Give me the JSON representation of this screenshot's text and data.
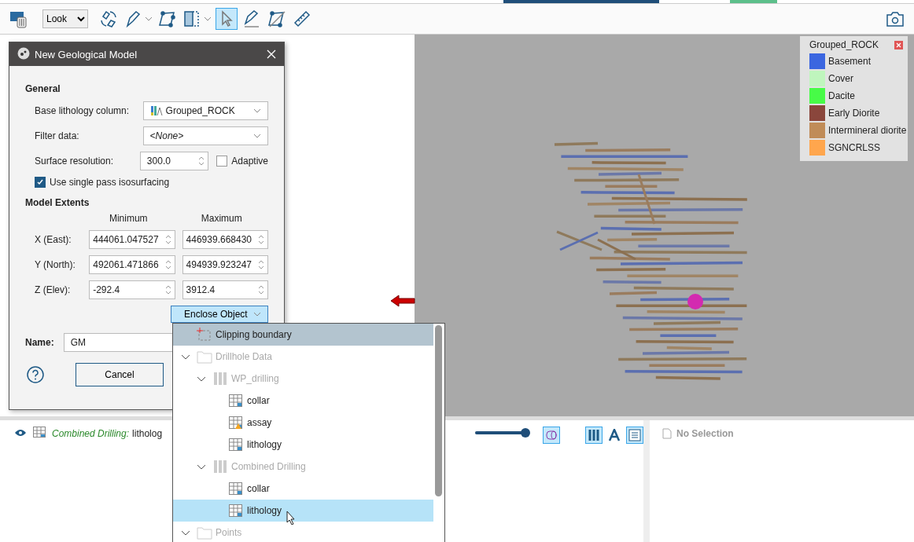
{
  "toolbar": {
    "view_mode": "Look",
    "tools": [
      {
        "kind": "layers",
        "selected": false,
        "menu": false
      },
      {
        "kind": "rotate",
        "selected": false,
        "menu": false
      },
      {
        "kind": "pen",
        "selected": false,
        "menu": true
      },
      {
        "kind": "polygon",
        "selected": false,
        "menu": false
      },
      {
        "kind": "slice",
        "selected": false,
        "menu": true
      },
      {
        "kind": "pointer",
        "selected": true,
        "menu": false
      },
      {
        "kind": "draw-line",
        "selected": false,
        "menu": false
      },
      {
        "kind": "polygon-edit",
        "selected": false,
        "menu": false
      },
      {
        "kind": "ruler",
        "selected": false,
        "menu": false
      }
    ]
  },
  "dialog": {
    "title": "New Geological Model",
    "general_heading": "General",
    "base_lithology": {
      "label": "Base lithology column:",
      "value": "Grouped_ROCK"
    },
    "filter": {
      "label": "Filter data:",
      "value": "<None>"
    },
    "resolution": {
      "label": "Surface resolution:",
      "value": "300.0",
      "adaptive_label": "Adaptive",
      "adaptive": false
    },
    "single_pass": {
      "label": "Use single pass isosurfacing",
      "checked": true
    },
    "extents_heading": "Model Extents",
    "min_heading": "Minimum",
    "max_heading": "Maximum",
    "extents": [
      {
        "label": "X (East):",
        "min": "444061.047527",
        "max": "446939.668430"
      },
      {
        "label": "Y (North):",
        "min": "492061.471866",
        "max": "494939.923247"
      },
      {
        "label": "Z (Elev):",
        "min": "-292.4",
        "max": "3912.4"
      }
    ],
    "enclose_button": "Enclose Object",
    "name_label": "Name:",
    "name_value": "GM",
    "cancel": "Cancel"
  },
  "enclose_menu": [
    {
      "label": "Clipping boundary",
      "kind": "boundary",
      "current": true,
      "selected": false,
      "disabled": false
    },
    {
      "label": "Drillhole Data",
      "kind": "folder",
      "current": false,
      "selected": false,
      "disabled": true,
      "expanded": true,
      "children": [
        {
          "label": "WP_drilling",
          "kind": "drillholes",
          "current": false,
          "selected": false,
          "disabled": true,
          "expanded": true,
          "children": [
            {
              "label": "collar",
              "kind": "table",
              "current": false,
              "selected": false,
              "disabled": false
            },
            {
              "label": "assay",
              "kind": "table-warning",
              "current": false,
              "selected": false,
              "disabled": false
            },
            {
              "label": "lithology",
              "kind": "table",
              "current": false,
              "selected": false,
              "disabled": false
            }
          ]
        },
        {
          "label": "Combined Drilling",
          "kind": "drillholes",
          "current": false,
          "selected": false,
          "disabled": true,
          "expanded": true,
          "children": [
            {
              "label": "collar",
              "kind": "table",
              "current": false,
              "selected": false,
              "disabled": false
            },
            {
              "label": "lithology",
              "kind": "table",
              "current": false,
              "selected": true,
              "disabled": false
            }
          ]
        }
      ]
    },
    {
      "label": "Points",
      "kind": "folder",
      "current": false,
      "selected": false,
      "disabled": true,
      "expanded": true
    }
  ],
  "legend": {
    "title": "Grouped_ROCK",
    "items": [
      {
        "label": "Basement",
        "color": "#3b66e0"
      },
      {
        "label": "Cover",
        "color": "#bff5bd"
      },
      {
        "label": "Dacite",
        "color": "#47fb47"
      },
      {
        "label": "Early Diorite",
        "color": "#8a463c"
      },
      {
        "label": "Intermineral diorite",
        "color": "#c08c58"
      },
      {
        "label": "SGNCRLSS",
        "color": "#ffa64d"
      }
    ]
  },
  "scene_list": {
    "row": {
      "visible": true,
      "object": "Combined Drilling:",
      "name": "litholog"
    }
  },
  "view_controls": {
    "opacity": {
      "level": 1
    }
  },
  "selection_panel": {
    "text": "No Selection"
  }
}
